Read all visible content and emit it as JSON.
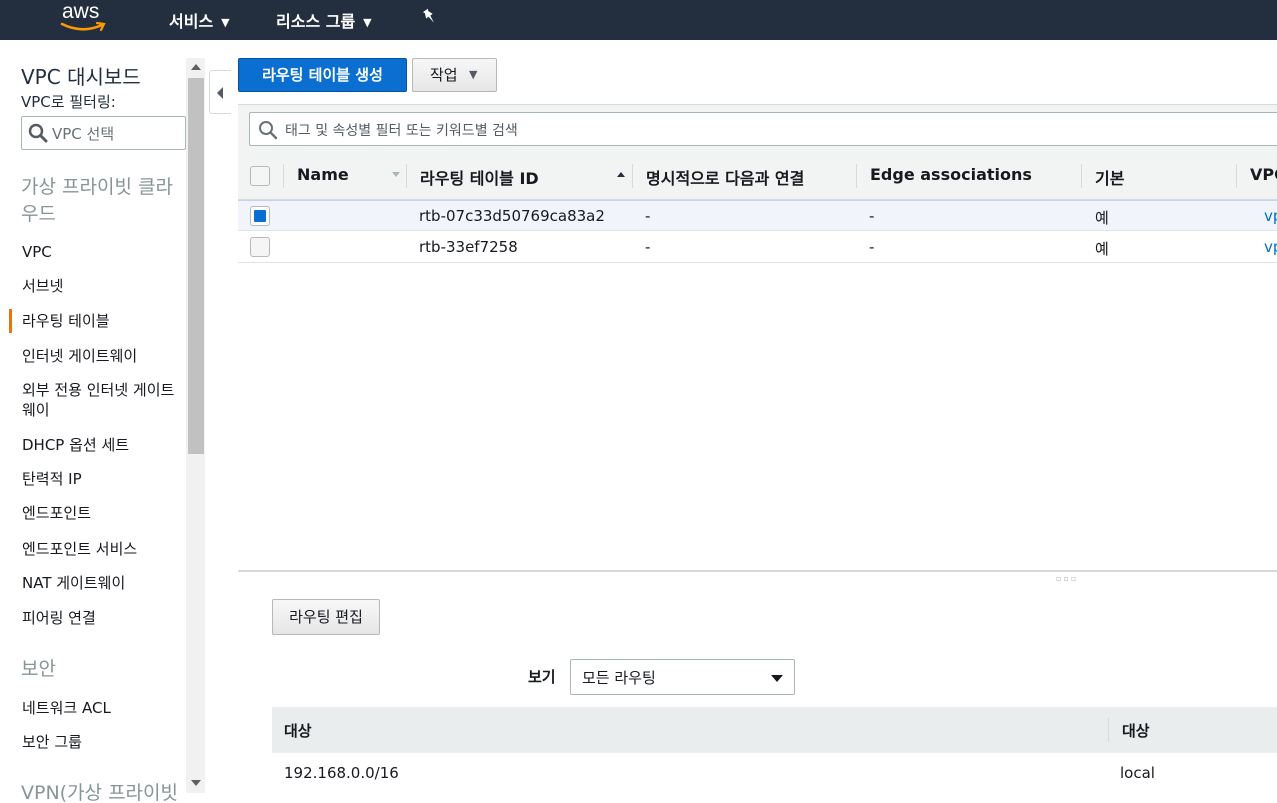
{
  "nav": {
    "logo": "aws",
    "services": "서비스",
    "resource_groups": "리소스 그룹"
  },
  "sidebar": {
    "title": "VPC 대시보드",
    "filter_label": "VPC로 필터링:",
    "filter_placeholder": "VPC 선택",
    "section_private_cloud": "가상 프라이빗 클라우드",
    "items": [
      {
        "label": "VPC"
      },
      {
        "label": "서브넷"
      },
      {
        "label": "라우팅 테이블",
        "active": true
      },
      {
        "label": "인터넷 게이트웨이"
      },
      {
        "label": "외부 전용 인터넷 게이트웨이"
      },
      {
        "label": "DHCP 옵션 세트"
      },
      {
        "label": "탄력적 IP"
      },
      {
        "label": "엔드포인트"
      },
      {
        "label": "엔드포인트 서비스"
      },
      {
        "label": "NAT 게이트웨이"
      },
      {
        "label": "피어링 연결"
      }
    ],
    "section_security": "보안",
    "security_items": [
      {
        "label": "네트워크 ACL"
      },
      {
        "label": "보안 그룹"
      }
    ],
    "section_vpn": "VPN(가상 프라이빗"
  },
  "toolbar": {
    "create_label": "라우팅 테이블 생성",
    "actions_label": "작업"
  },
  "search": {
    "placeholder": "태그 및 속성별 필터 또는 키워드별 검색"
  },
  "table": {
    "columns": [
      "Name",
      "라우팅 테이블 ID",
      "명시적으로 다음과 연결",
      "Edge associations",
      "기본",
      "VPC"
    ],
    "rows": [
      {
        "name": "",
        "id": "rtb-07c33d50769ca83a2",
        "explicit": "-",
        "edge": "-",
        "main": "예",
        "vpc": "vp",
        "selected": true
      },
      {
        "name": "",
        "id": "rtb-33ef7258",
        "explicit": "-",
        "edge": "-",
        "main": "예",
        "vpc": "vp",
        "selected": false
      }
    ]
  },
  "detail": {
    "edit_label": "라우팅 편집",
    "view_label": "보기",
    "view_value": "모든 라우팅",
    "columns": [
      "대상",
      "대상"
    ],
    "routes": [
      {
        "destination": "192.168.0.0/16",
        "target": "local"
      }
    ]
  },
  "colors": {
    "nav_bg": "#232f3e",
    "primary": "#0a6fd1",
    "active_accent": "#ec7211",
    "link": "#0073bb"
  }
}
